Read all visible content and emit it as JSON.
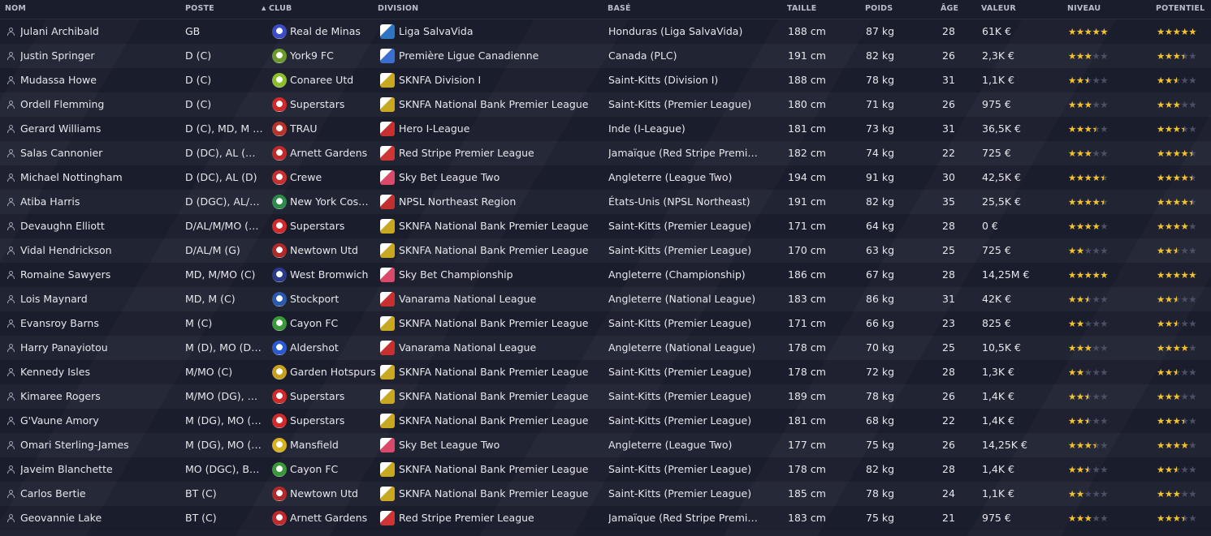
{
  "headers": {
    "name": "NOM",
    "position": "POSTE",
    "club": "CLUB",
    "division": "DIVISION",
    "based": "BASÉ",
    "height": "TAILLE",
    "weight": "POIDS",
    "age": "ÂGE",
    "value": "VALEUR",
    "level": "NIVEAU",
    "potential": "POTENTIEL"
  },
  "sort_indicator": "▲",
  "rows": [
    {
      "name": "Julani Archibald",
      "position": "GB",
      "club": "Real de Minas",
      "club_color": "#3b4cc9",
      "division": "Liga SalvaVida",
      "div_color": "#2f74c0",
      "based": "Honduras (Liga SalvaVida)",
      "height": "188 cm",
      "weight": "87 kg",
      "age": "28",
      "value": "61K €",
      "level": 5,
      "potential": 5
    },
    {
      "name": "Justin Springer",
      "position": "D (C)",
      "club": "York9 FC",
      "club_color": "#6a9a2b",
      "division": "Première Ligue Canadienne",
      "div_color": "#3a6ed0",
      "based": "Canada (PLC)",
      "height": "191 cm",
      "weight": "82 kg",
      "age": "26",
      "value": "2,3K €",
      "level": 3,
      "potential": 3.5
    },
    {
      "name": "Mudassa Howe",
      "position": "D (C)",
      "club": "Conaree Utd",
      "club_color": "#8bbf2a",
      "division": "SKNFA Division I",
      "div_color": "#c8a820",
      "based": "Saint-Kitts (Division I)",
      "height": "188 cm",
      "weight": "78 kg",
      "age": "31",
      "value": "1,1K €",
      "level": 2.5,
      "potential": 2.5
    },
    {
      "name": "Ordell Flemming",
      "position": "D (C)",
      "club": "Superstars",
      "club_color": "#d02a2a",
      "division": "SKNFA National Bank Premier League",
      "div_color": "#c8a820",
      "based": "Saint-Kitts (Premier League)",
      "height": "180 cm",
      "weight": "71 kg",
      "age": "26",
      "value": "975 €",
      "level": 3,
      "potential": 3
    },
    {
      "name": "Gerard Williams",
      "position": "D (C), MD, M (C)",
      "club": "TRAU",
      "club_color": "#b8342a",
      "division": "Hero I-League",
      "div_color": "#c83030",
      "based": "Inde (I-League)",
      "height": "181 cm",
      "weight": "73 kg",
      "age": "31",
      "value": "36,5K €",
      "level": 3.5,
      "potential": 3.5
    },
    {
      "name": "Salas Cannonier",
      "position": "D (DC), AL (D),...",
      "club": "Arnett Gardens",
      "club_color": "#c02a2a",
      "division": "Red Stripe Premier League",
      "div_color": "#d03535",
      "based": "Jamaïque (Red Stripe Premier...",
      "height": "182 cm",
      "weight": "74 kg",
      "age": "22",
      "value": "725 €",
      "level": 3,
      "potential": 4.5
    },
    {
      "name": "Michael Nottingham",
      "position": "D (DC), AL (D)",
      "club": "Crewe",
      "club_color": "#c83030",
      "division": "Sky Bet League Two",
      "div_color": "#d94a6a",
      "based": "Angleterre (League Two)",
      "height": "194 cm",
      "weight": "91 kg",
      "age": "30",
      "value": "42,5K €",
      "level": 4.5,
      "potential": 4.5
    },
    {
      "name": "Atiba Harris",
      "position": "D (DGC), AL/M...",
      "club": "New York Cosmos",
      "club_color": "#2e8a4a",
      "division": "NPSL Northeast Region",
      "div_color": "#c03030",
      "based": "États-Unis (NPSL Northeast)",
      "height": "191 cm",
      "weight": "82 kg",
      "age": "35",
      "value": "25,5K €",
      "level": 4.5,
      "potential": 4.5
    },
    {
      "name": "Devaughn Elliott",
      "position": "D/AL/M/MO (D...",
      "club": "Superstars",
      "club_color": "#d02a2a",
      "division": "SKNFA National Bank Premier League",
      "div_color": "#c8a820",
      "based": "Saint-Kitts (Premier League)",
      "height": "171 cm",
      "weight": "64 kg",
      "age": "28",
      "value": "0 €",
      "level": 4,
      "potential": 4
    },
    {
      "name": "Vidal Hendrickson",
      "position": "D/AL/M (G)",
      "club": "Newtown Utd",
      "club_color": "#b02a2a",
      "division": "SKNFA National Bank Premier League",
      "div_color": "#c8a820",
      "based": "Saint-Kitts (Premier League)",
      "height": "170 cm",
      "weight": "63 kg",
      "age": "25",
      "value": "725 €",
      "level": 2,
      "potential": 2.5
    },
    {
      "name": "Romaine Sawyers",
      "position": "MD, M/MO (C)",
      "club": "West Bromwich",
      "club_color": "#2a3a8a",
      "division": "Sky Bet Championship",
      "div_color": "#d94a6a",
      "based": "Angleterre (Championship)",
      "height": "186 cm",
      "weight": "67 kg",
      "age": "28",
      "value": "14,25M €",
      "level": 5,
      "potential": 5
    },
    {
      "name": "Lois Maynard",
      "position": "MD, M (C)",
      "club": "Stockport",
      "club_color": "#2a5ab0",
      "division": "Vanarama National League",
      "div_color": "#c83030",
      "based": "Angleterre (National League)",
      "height": "183 cm",
      "weight": "86 kg",
      "age": "31",
      "value": "42K €",
      "level": 2.5,
      "potential": 2.5
    },
    {
      "name": "Evansroy Barns",
      "position": "M (C)",
      "club": "Cayon FC",
      "club_color": "#3a9a3a",
      "division": "SKNFA National Bank Premier League",
      "div_color": "#c8a820",
      "based": "Saint-Kitts (Premier League)",
      "height": "171 cm",
      "weight": "66 kg",
      "age": "23",
      "value": "825 €",
      "level": 2,
      "potential": 2.5
    },
    {
      "name": "Harry Panayiotou",
      "position": "M (D), MO (DC),...",
      "club": "Aldershot",
      "club_color": "#2a5ad0",
      "division": "Vanarama National League",
      "div_color": "#c83030",
      "based": "Angleterre (National League)",
      "height": "178 cm",
      "weight": "70 kg",
      "age": "25",
      "value": "10,5K €",
      "level": 3,
      "potential": 4
    },
    {
      "name": "Kennedy Isles",
      "position": "M/MO (C)",
      "club": "Garden Hotspurs",
      "club_color": "#c8a020",
      "division": "SKNFA National Bank Premier League",
      "div_color": "#c8a820",
      "based": "Saint-Kitts (Premier League)",
      "height": "178 cm",
      "weight": "72 kg",
      "age": "28",
      "value": "1,3K €",
      "level": 2,
      "potential": 2.5
    },
    {
      "name": "Kimaree Rogers",
      "position": "M/MO (DG), BT...",
      "club": "Superstars",
      "club_color": "#d02a2a",
      "division": "SKNFA National Bank Premier League",
      "div_color": "#c8a820",
      "based": "Saint-Kitts (Premier League)",
      "height": "189 cm",
      "weight": "78 kg",
      "age": "26",
      "value": "1,4K €",
      "level": 2.5,
      "potential": 3
    },
    {
      "name": "G'Vaune Amory",
      "position": "M (DG), MO (D...",
      "club": "Superstars",
      "club_color": "#d02a2a",
      "division": "SKNFA National Bank Premier League",
      "div_color": "#c8a820",
      "based": "Saint-Kitts (Premier League)",
      "height": "181 cm",
      "weight": "68 kg",
      "age": "22",
      "value": "1,4K €",
      "level": 2.5,
      "potential": 3.5
    },
    {
      "name": "Omari Sterling-James",
      "position": "M (DG), MO (G...",
      "club": "Mansfield",
      "club_color": "#d8b020",
      "division": "Sky Bet League Two",
      "div_color": "#d94a6a",
      "based": "Angleterre (League Two)",
      "height": "177 cm",
      "weight": "75 kg",
      "age": "26",
      "value": "14,25K €",
      "level": 3.5,
      "potential": 4
    },
    {
      "name": "Javeim Blanchette",
      "position": "MO (DGC), BT (...",
      "club": "Cayon FC",
      "club_color": "#3a9a3a",
      "division": "SKNFA National Bank Premier League",
      "div_color": "#c8a820",
      "based": "Saint-Kitts (Premier League)",
      "height": "178 cm",
      "weight": "82 kg",
      "age": "28",
      "value": "1,4K €",
      "level": 2.5,
      "potential": 2.5
    },
    {
      "name": "Carlos Bertie",
      "position": "BT (C)",
      "club": "Newtown Utd",
      "club_color": "#b02a2a",
      "division": "SKNFA National Bank Premier League",
      "div_color": "#c8a820",
      "based": "Saint-Kitts (Premier League)",
      "height": "185 cm",
      "weight": "78 kg",
      "age": "24",
      "value": "1,1K €",
      "level": 2,
      "potential": 3
    },
    {
      "name": "Geovannie Lake",
      "position": "BT (C)",
      "club": "Arnett Gardens",
      "club_color": "#c02a2a",
      "division": "Red Stripe Premier League",
      "div_color": "#d03535",
      "based": "Jamaïque (Red Stripe Premier...",
      "height": "183 cm",
      "weight": "75 kg",
      "age": "21",
      "value": "975 €",
      "level": 3,
      "potential": 3.5
    }
  ]
}
